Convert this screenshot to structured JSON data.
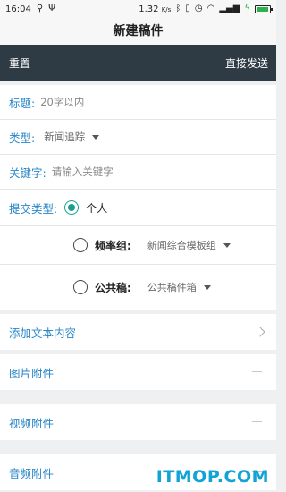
{
  "status": {
    "time": "16:04",
    "speed": "1.32",
    "speed_unit": "K/s"
  },
  "app": {
    "title": "新建稿件"
  },
  "toolbar": {
    "reset": "重置",
    "send": "直接发送"
  },
  "form": {
    "title_label": "标题:",
    "title_placeholder": "20字以内",
    "type_label": "类型:",
    "type_value": "新闻追踪",
    "keyword_label": "关键字:",
    "keyword_placeholder": "请输入关键字",
    "submit_type_label": "提交类型:",
    "options": {
      "personal": "个人",
      "frequency": "频率组:",
      "frequency_value": "新闻综合模板组",
      "public": "公共稿:",
      "public_value": "公共稿件箱"
    }
  },
  "sections": {
    "text": "添加文本内容",
    "image": "图片附件",
    "video": "视频附件",
    "audio": "音频附件"
  },
  "watermark": "ITMOP.COM",
  "colors": {
    "accent": "#2a87c8",
    "toolbar_bg": "#2f3b44",
    "radio_on": "#18a08c"
  }
}
